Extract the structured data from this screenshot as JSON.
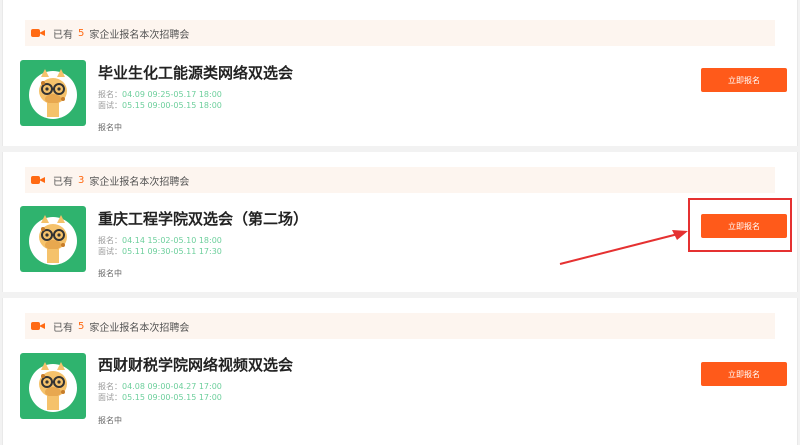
{
  "colors": {
    "accent": "#ff5a1a",
    "date_green": "#6dcf9c",
    "notice_bg": "#fdf5ef",
    "annotation_red": "#e53131"
  },
  "events": [
    {
      "notice_prefix": "已有",
      "count": "5",
      "notice_suffix": "家企业报名本次招聘会",
      "title": "毕业生化工能源类网络双选会",
      "signup_label": "报名：",
      "signup_time": "04.09 09:25-05.17 18:00",
      "interview_label": "面试：",
      "interview_time": "05.15 09:00-05.15 18:00",
      "status": "报名中",
      "button": "立即报名"
    },
    {
      "notice_prefix": "已有",
      "count": "3",
      "notice_suffix": "家企业报名本次招聘会",
      "title": "重庆工程学院双选会（第二场）",
      "signup_label": "报名：",
      "signup_time": "04.14 15:02-05.10 18:00",
      "interview_label": "面试：",
      "interview_time": "05.11 09:30-05.11 17:30",
      "status": "报名中",
      "button": "立即报名"
    },
    {
      "notice_prefix": "已有",
      "count": "5",
      "notice_suffix": "家企业报名本次招聘会",
      "title": "西财财税学院网络视频双选会",
      "signup_label": "报名：",
      "signup_time": "04.08 09:00-04.27 17:00",
      "interview_label": "面试：",
      "interview_time": "05.15 09:00-05.15 17:00",
      "status": "报名中",
      "button": "立即报名"
    }
  ],
  "icons": {
    "notice": "video-camera-icon",
    "logo": "giraffe-mascot-logo",
    "annotation": "red-arrow-annotation"
  }
}
